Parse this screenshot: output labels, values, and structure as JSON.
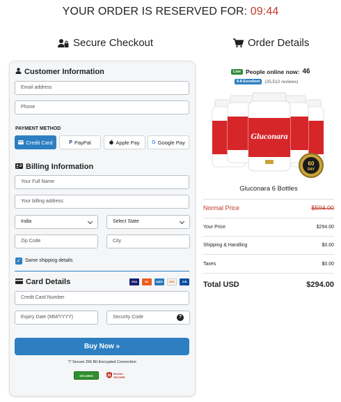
{
  "timer": {
    "label": "YOUR ORDER IS RESERVED FOR:",
    "time": "09:44"
  },
  "headings": {
    "checkout": "Secure Checkout",
    "order": "Order Details"
  },
  "customer": {
    "title": "Customer Information",
    "email_placeholder": "Email address",
    "phone_placeholder": "Phone"
  },
  "payment": {
    "label": "PAYMENT METHOD",
    "methods": [
      "Credit Card",
      "PayPal",
      "Apple Pay",
      "Google Pay"
    ],
    "active": "Credit Card"
  },
  "billing": {
    "title": "Billing Information",
    "name_placeholder": "Your Full Name",
    "address_placeholder": "Your billing address",
    "country": "India",
    "state": "Select State",
    "zip_placeholder": "Zip Code",
    "city_placeholder": "City",
    "same_shipping": "Same shipping details"
  },
  "card_details": {
    "title": "Card Details",
    "number_placeholder": "Credit Card Number",
    "expiry_placeholder": "Expiry Date (MM/YYYY)",
    "cvv_placeholder": "Security Code",
    "card_logos": [
      "VISA",
      "MC",
      "AMEX",
      "DISC",
      "JCB"
    ]
  },
  "buy_button": "Buy Now »",
  "secure_text": "Secure 256 Bit Encrypted Connection",
  "badges": {
    "secured": "SECURED",
    "mcafee": "McAfee SECURE"
  },
  "colors": {
    "accent": "#2d7fc1",
    "timer": "#c0392b",
    "live": "#2e8b3a"
  },
  "order": {
    "live_label": "Live",
    "online_label": "People online now:",
    "online_count": "46",
    "rating_badge": "9.8 Excellent",
    "reviews": "(25,512 reviews)",
    "product_brand": "Gluconara",
    "seal_top": "60",
    "seal_bottom": "DAY",
    "product_name": "Gluconara 6 Bottles",
    "normal_price_label": "Normal Price",
    "normal_price": "$594.00",
    "your_price_label": "Your Price",
    "your_price": "$294.00",
    "shipping_label": "Shipping & Handling",
    "shipping": "$0.00",
    "taxes_label": "Taxes",
    "taxes": "$0.00",
    "total_label": "Total USD",
    "total": "$294.00"
  }
}
